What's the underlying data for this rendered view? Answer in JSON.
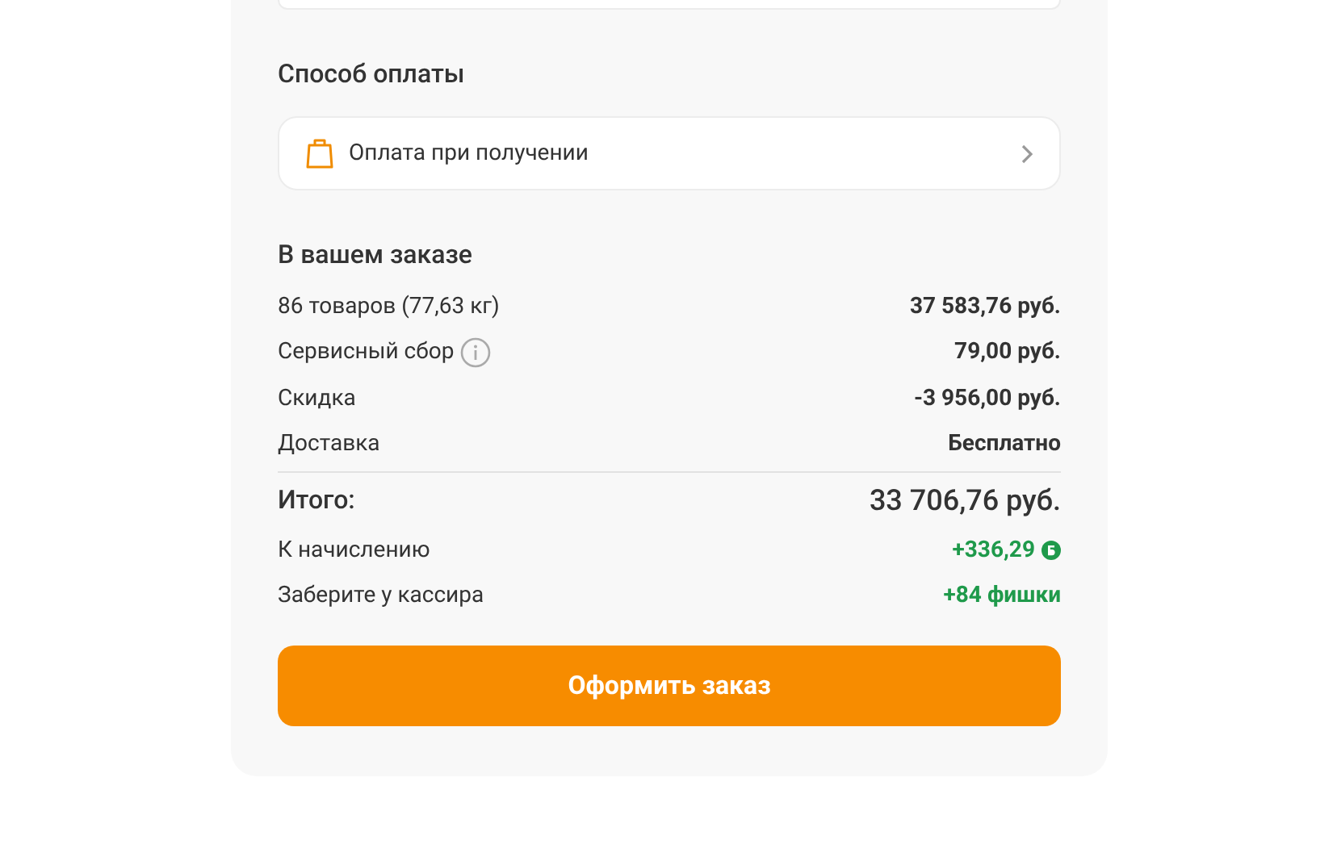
{
  "payment": {
    "title": "Способ оплаты",
    "method": "Оплата при получении"
  },
  "order": {
    "title": "В вашем заказе",
    "lines": [
      {
        "kind": "plain",
        "label": "86 товаров (77,63 кг)",
        "value": "37 583,76 руб."
      },
      {
        "kind": "info",
        "label": "Сервисный сбор",
        "value": "79,00 руб."
      },
      {
        "kind": "plain",
        "label": "Скидка",
        "value": "-3 956,00 руб."
      },
      {
        "kind": "plain",
        "label": "Доставка",
        "value": "Бесплатно"
      }
    ],
    "total": {
      "label": "Итого:",
      "value": "33 706,76 руб."
    },
    "rewards": [
      {
        "kind": "bonus",
        "label": "К начислению",
        "value": "+336,29"
      },
      {
        "kind": "plain",
        "label": "Заберите у кассира",
        "value": "+84 фишки"
      }
    ]
  },
  "submit": "Оформить заказ"
}
